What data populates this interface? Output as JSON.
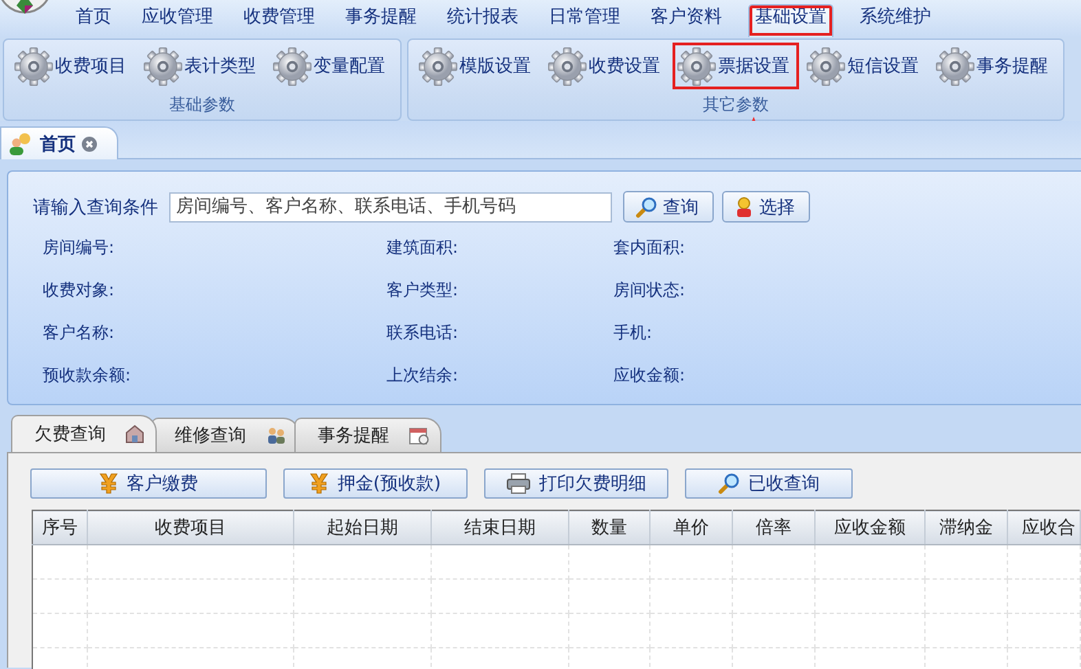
{
  "menu": [
    {
      "label": "首页",
      "selected": false,
      "highlighted": false
    },
    {
      "label": "应收管理",
      "selected": false,
      "highlighted": false
    },
    {
      "label": "收费管理",
      "selected": false,
      "highlighted": false
    },
    {
      "label": "事务提醒",
      "selected": false,
      "highlighted": false
    },
    {
      "label": "统计报表",
      "selected": false,
      "highlighted": false
    },
    {
      "label": "日常管理",
      "selected": false,
      "highlighted": false
    },
    {
      "label": "客户资料",
      "selected": false,
      "highlighted": false
    },
    {
      "label": "基础设置",
      "selected": true,
      "highlighted": true
    },
    {
      "label": "系统维护",
      "selected": false,
      "highlighted": false
    }
  ],
  "ribbon_groups": [
    {
      "label": "基础参数",
      "buttons": [
        {
          "label": "收费项目",
          "highlighted": false
        },
        {
          "label": "表计类型",
          "highlighted": false
        },
        {
          "label": "变量配置",
          "highlighted": false
        }
      ]
    },
    {
      "label": "其它参数",
      "buttons": [
        {
          "label": "模版设置",
          "highlighted": false
        },
        {
          "label": "收费设置",
          "highlighted": false
        },
        {
          "label": "票据设置",
          "highlighted": true
        },
        {
          "label": "短信设置",
          "highlighted": false
        },
        {
          "label": "事务提醒",
          "highlighted": false
        }
      ]
    }
  ],
  "document_tabs": [
    {
      "label": "首页",
      "selected": true,
      "closable": true
    }
  ],
  "query": {
    "label": "请输入查询条件",
    "placeholder": "房间编号、客户名称、联系电话、手机号码",
    "buttons": [
      {
        "label": "查询",
        "kind": "search"
      },
      {
        "label": "选择",
        "kind": "person"
      }
    ]
  },
  "info_fields": [
    {
      "label": "房间编号:"
    },
    {
      "label": "建筑面积:"
    },
    {
      "label": "套内面积:"
    },
    {
      "label": "收费对象:"
    },
    {
      "label": "客户类型:"
    },
    {
      "label": "房间状态:"
    },
    {
      "label": "客户名称:"
    },
    {
      "label": "联系电话:"
    },
    {
      "label": "手机:"
    },
    {
      "label": "预收款余额:"
    },
    {
      "label": "上次结余:"
    },
    {
      "label": "应收金额:"
    }
  ],
  "detail_tabs": [
    {
      "label": "欠费查询",
      "selected": true,
      "kind": "house"
    },
    {
      "label": "维修查询",
      "selected": false,
      "kind": "people"
    },
    {
      "label": "事务提醒",
      "selected": false,
      "kind": "calendar"
    }
  ],
  "toolbar": [
    {
      "label": "客户缴费",
      "kind": "yen"
    },
    {
      "label": "押金(预收款)",
      "kind": "yen"
    },
    {
      "label": "打印欠费明细",
      "kind": "printer"
    },
    {
      "label": "已收查询",
      "kind": "search"
    }
  ],
  "table": {
    "columns": [
      "序号",
      "收费项目",
      "起始日期",
      "结束日期",
      "数量",
      "单价",
      "倍率",
      "应收金额",
      "滞纳金",
      "应收合"
    ]
  }
}
